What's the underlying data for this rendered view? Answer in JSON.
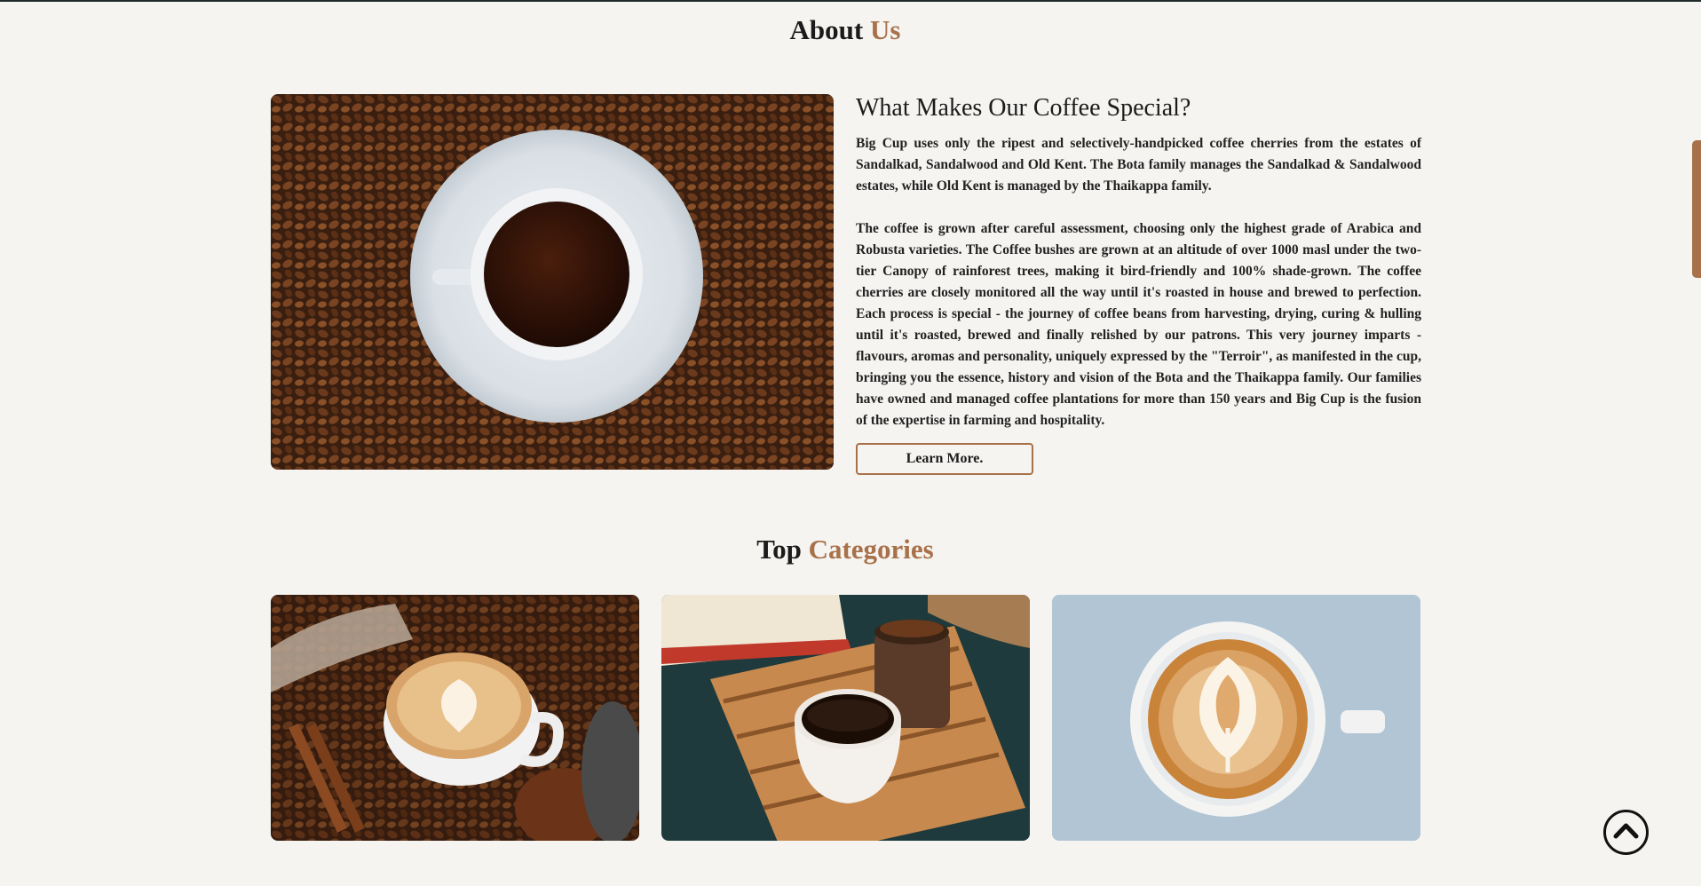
{
  "about": {
    "title_main": "About",
    "title_accent": "Us",
    "heading": "What Makes Our Coffee Special?",
    "paragraph_1": "Big Cup uses only the ripest and selectively-handpicked coffee cherries from the estates of Sandalkad, Sandalwood and Old Kent. The Bota family manages the Sandalkad & Sandalwood estates, while Old Kent is managed by the Thaikappa family.",
    "paragraph_2": "The coffee is grown after careful assessment, choosing only the highest grade of Arabica and Robusta varieties. The Coffee bushes are grown at an altitude of over 1000 masl under the two-tier Canopy of rainforest trees, making it bird-friendly and 100% shade-grown. The coffee cherries are closely monitored all the way until it's roasted in house and brewed to perfection. Each process is special - the journey of coffee beans from harvesting, drying, curing & hulling until it's roasted, brewed and finally relished by our patrons. This very journey imparts - flavours, aromas and personality, uniquely expressed by the \"Terroir\", as manifested in the cup, bringing you the essence, history and vision of the Bota and the Thaikappa family. Our families have owned and managed coffee plantations for more than 150 years and Big Cup is the fusion of the expertise in farming and hospitality.",
    "button_label": "Learn More."
  },
  "categories": {
    "title_main": "Top",
    "title_accent": "Categories",
    "cards": [
      {
        "image": "latte-with-cinnamon-and-beans-photo"
      },
      {
        "image": "black-coffee-on-wooden-tray-photo"
      },
      {
        "image": "latte-art-cup-on-blue-table-photo"
      }
    ]
  },
  "colors": {
    "accent": "#a8714a",
    "background": "#f5f4f1",
    "text": "#1b1b1b"
  },
  "icons": {
    "scroll_top": "chevron-up-circle-icon"
  }
}
